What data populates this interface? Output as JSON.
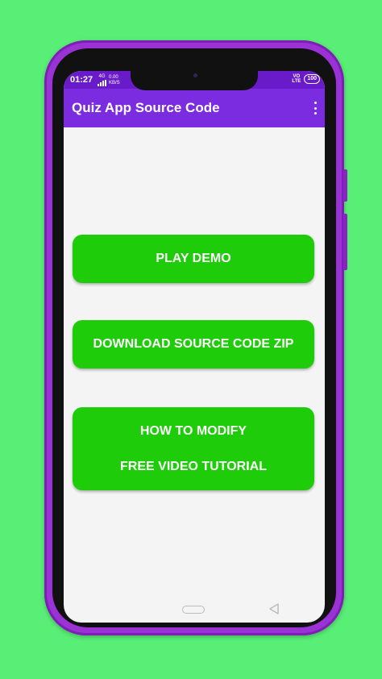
{
  "status_bar": {
    "time": "01:27",
    "network_top": "4G",
    "speed_value": "0.00",
    "speed_unit": "KB/S",
    "volte_top": "VO",
    "volte_bottom": "LTE",
    "battery": "100"
  },
  "app_bar": {
    "title": "Quiz App Source Code",
    "menu_icon": "more-vert-icon"
  },
  "buttons": {
    "play_demo": "PLAY DEMO",
    "download_zip": "DOWNLOAD SOURCE CODE ZIP",
    "modify_line1": "HOW TO MODIFY",
    "modify_line2": "FREE VIDEO TUTORIAL"
  },
  "colors": {
    "background": "#59ef77",
    "phone_frame": "#9b32d6",
    "app_bar": "#7b2be0",
    "status_bar": "#6a1bc9",
    "button": "#1fcc0a",
    "screen": "#f4f4f4"
  }
}
